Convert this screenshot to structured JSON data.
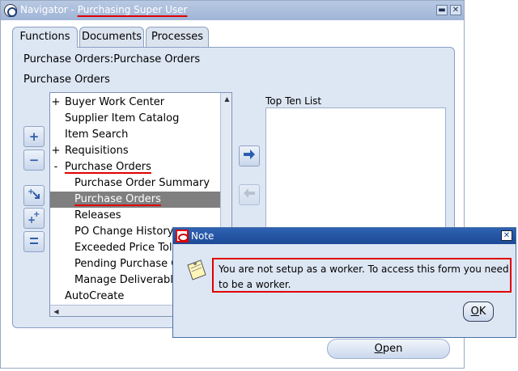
{
  "window": {
    "title_prefix": "Navigator - ",
    "title_user": "Purchasing Super User"
  },
  "tabs": [
    {
      "label": "Functions",
      "active": true
    },
    {
      "label": "Documents",
      "active": false
    },
    {
      "label": "Processes",
      "active": false
    }
  ],
  "breadcrumb": "Purchase Orders:Purchase Orders",
  "section_title": "Purchase Orders",
  "side_buttons": [
    "expand-icon",
    "collapse-icon",
    "expand-branch-icon",
    "expand-all-icon",
    "collapse-all-icon"
  ],
  "tree": [
    {
      "toggle": "+",
      "label": "Buyer Work Center",
      "level": 0
    },
    {
      "toggle": "",
      "label": "Supplier Item Catalog",
      "level": 0
    },
    {
      "toggle": "",
      "label": "Item Search",
      "level": 0
    },
    {
      "toggle": "+",
      "label": "Requisitions",
      "level": 0
    },
    {
      "toggle": "-",
      "label": "Purchase Orders",
      "level": 0
    },
    {
      "toggle": "",
      "label": "Purchase Order Summary",
      "level": 1
    },
    {
      "toggle": "",
      "label": "Purchase Orders",
      "level": 1
    },
    {
      "toggle": "",
      "label": "Releases",
      "level": 1
    },
    {
      "toggle": "",
      "label": "PO Change History",
      "level": 1
    },
    {
      "toggle": "",
      "label": "Exceeded Price Tolerances",
      "level": 1
    },
    {
      "toggle": "",
      "label": "Pending Purchase Orders",
      "level": 1
    },
    {
      "toggle": "",
      "label": "Manage Deliverables",
      "level": 1
    },
    {
      "toggle": "",
      "label": "AutoCreate",
      "level": 0
    }
  ],
  "top_ten_label": "Top Ten List",
  "open_button": {
    "accel": "O",
    "rest": "pen"
  },
  "note": {
    "title": "Note",
    "message": "You are not setup as a worker.  To access this form you need to be a worker.",
    "ok": {
      "accel": "O",
      "rest": "K"
    }
  },
  "colors": {
    "highlight": "#e00000",
    "selected_row": "#7f7f7f",
    "note_title": "#1c4a96"
  }
}
